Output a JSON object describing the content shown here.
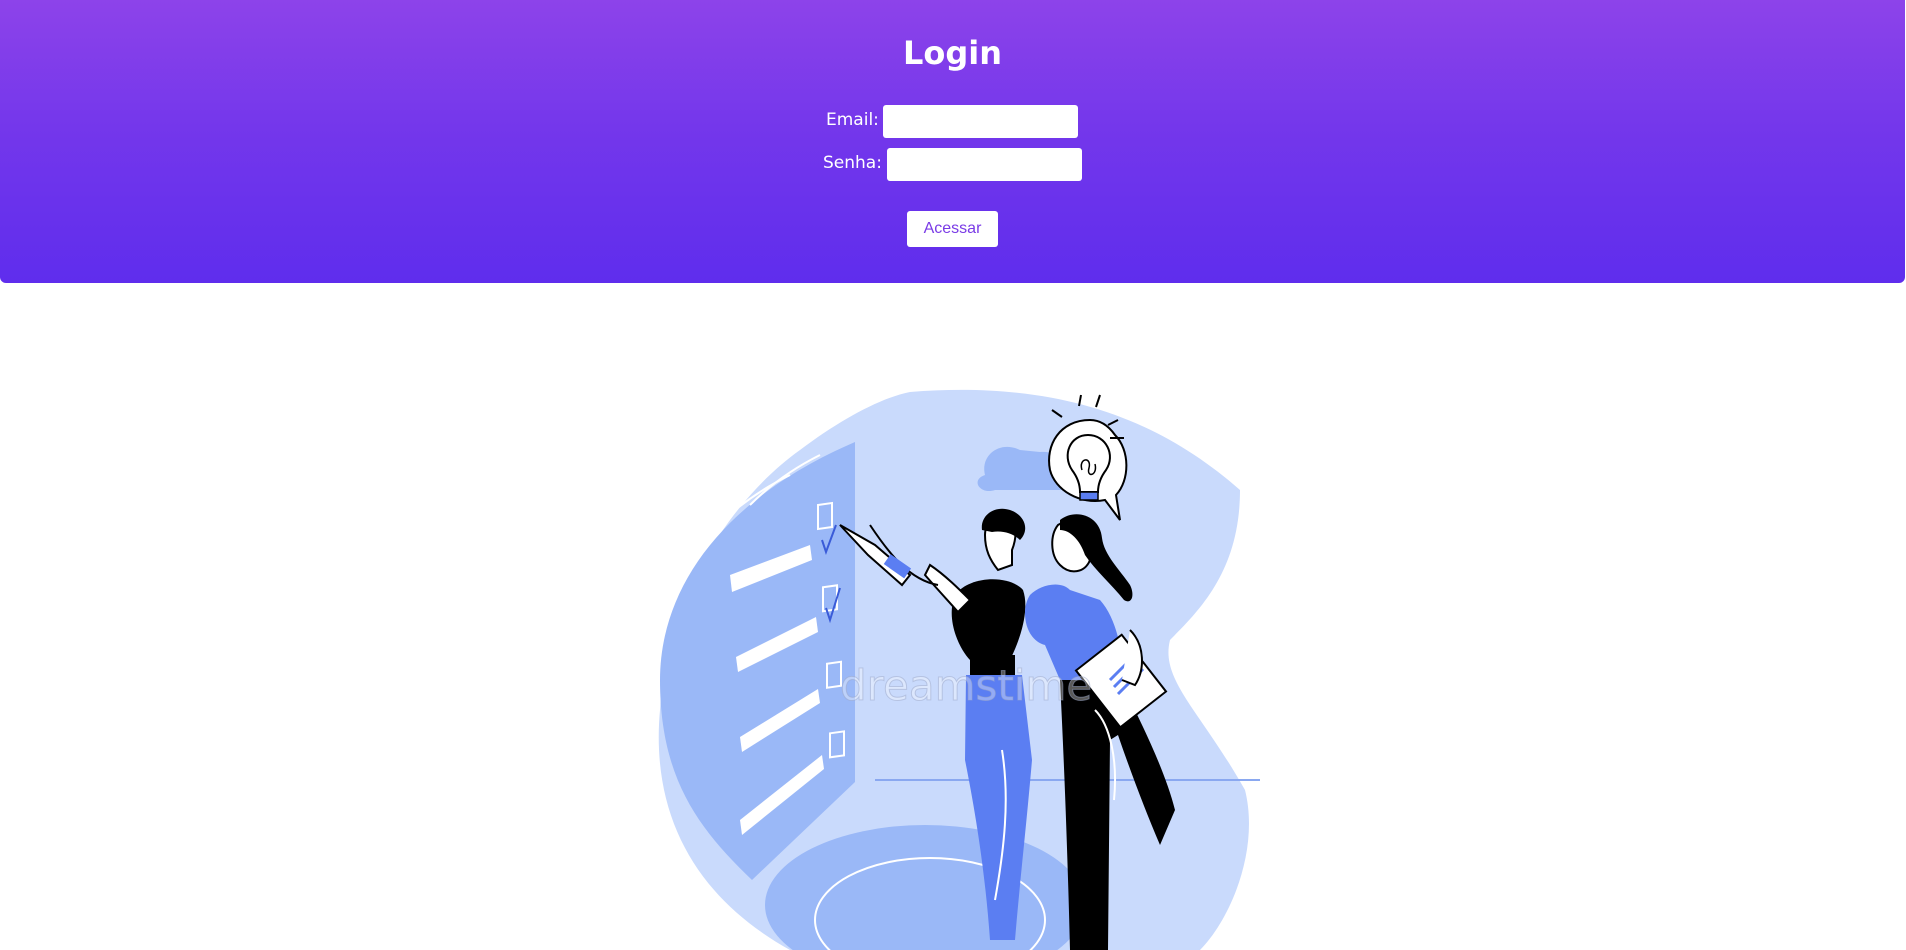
{
  "login": {
    "title": "Login",
    "email_label": "Email:",
    "email_value": "",
    "password_label": "Senha:",
    "password_value": "",
    "submit_label": "Acessar"
  },
  "illustration": {
    "watermark": "dreamstime"
  },
  "colors": {
    "gradient_top": "#8d43ea",
    "gradient_bottom": "#5f2ded",
    "button_text": "#7a3be6",
    "illustration_blue": "#5b7ef2",
    "illustration_light": "#c9dafc",
    "illustration_mid": "#9ab8f7"
  }
}
